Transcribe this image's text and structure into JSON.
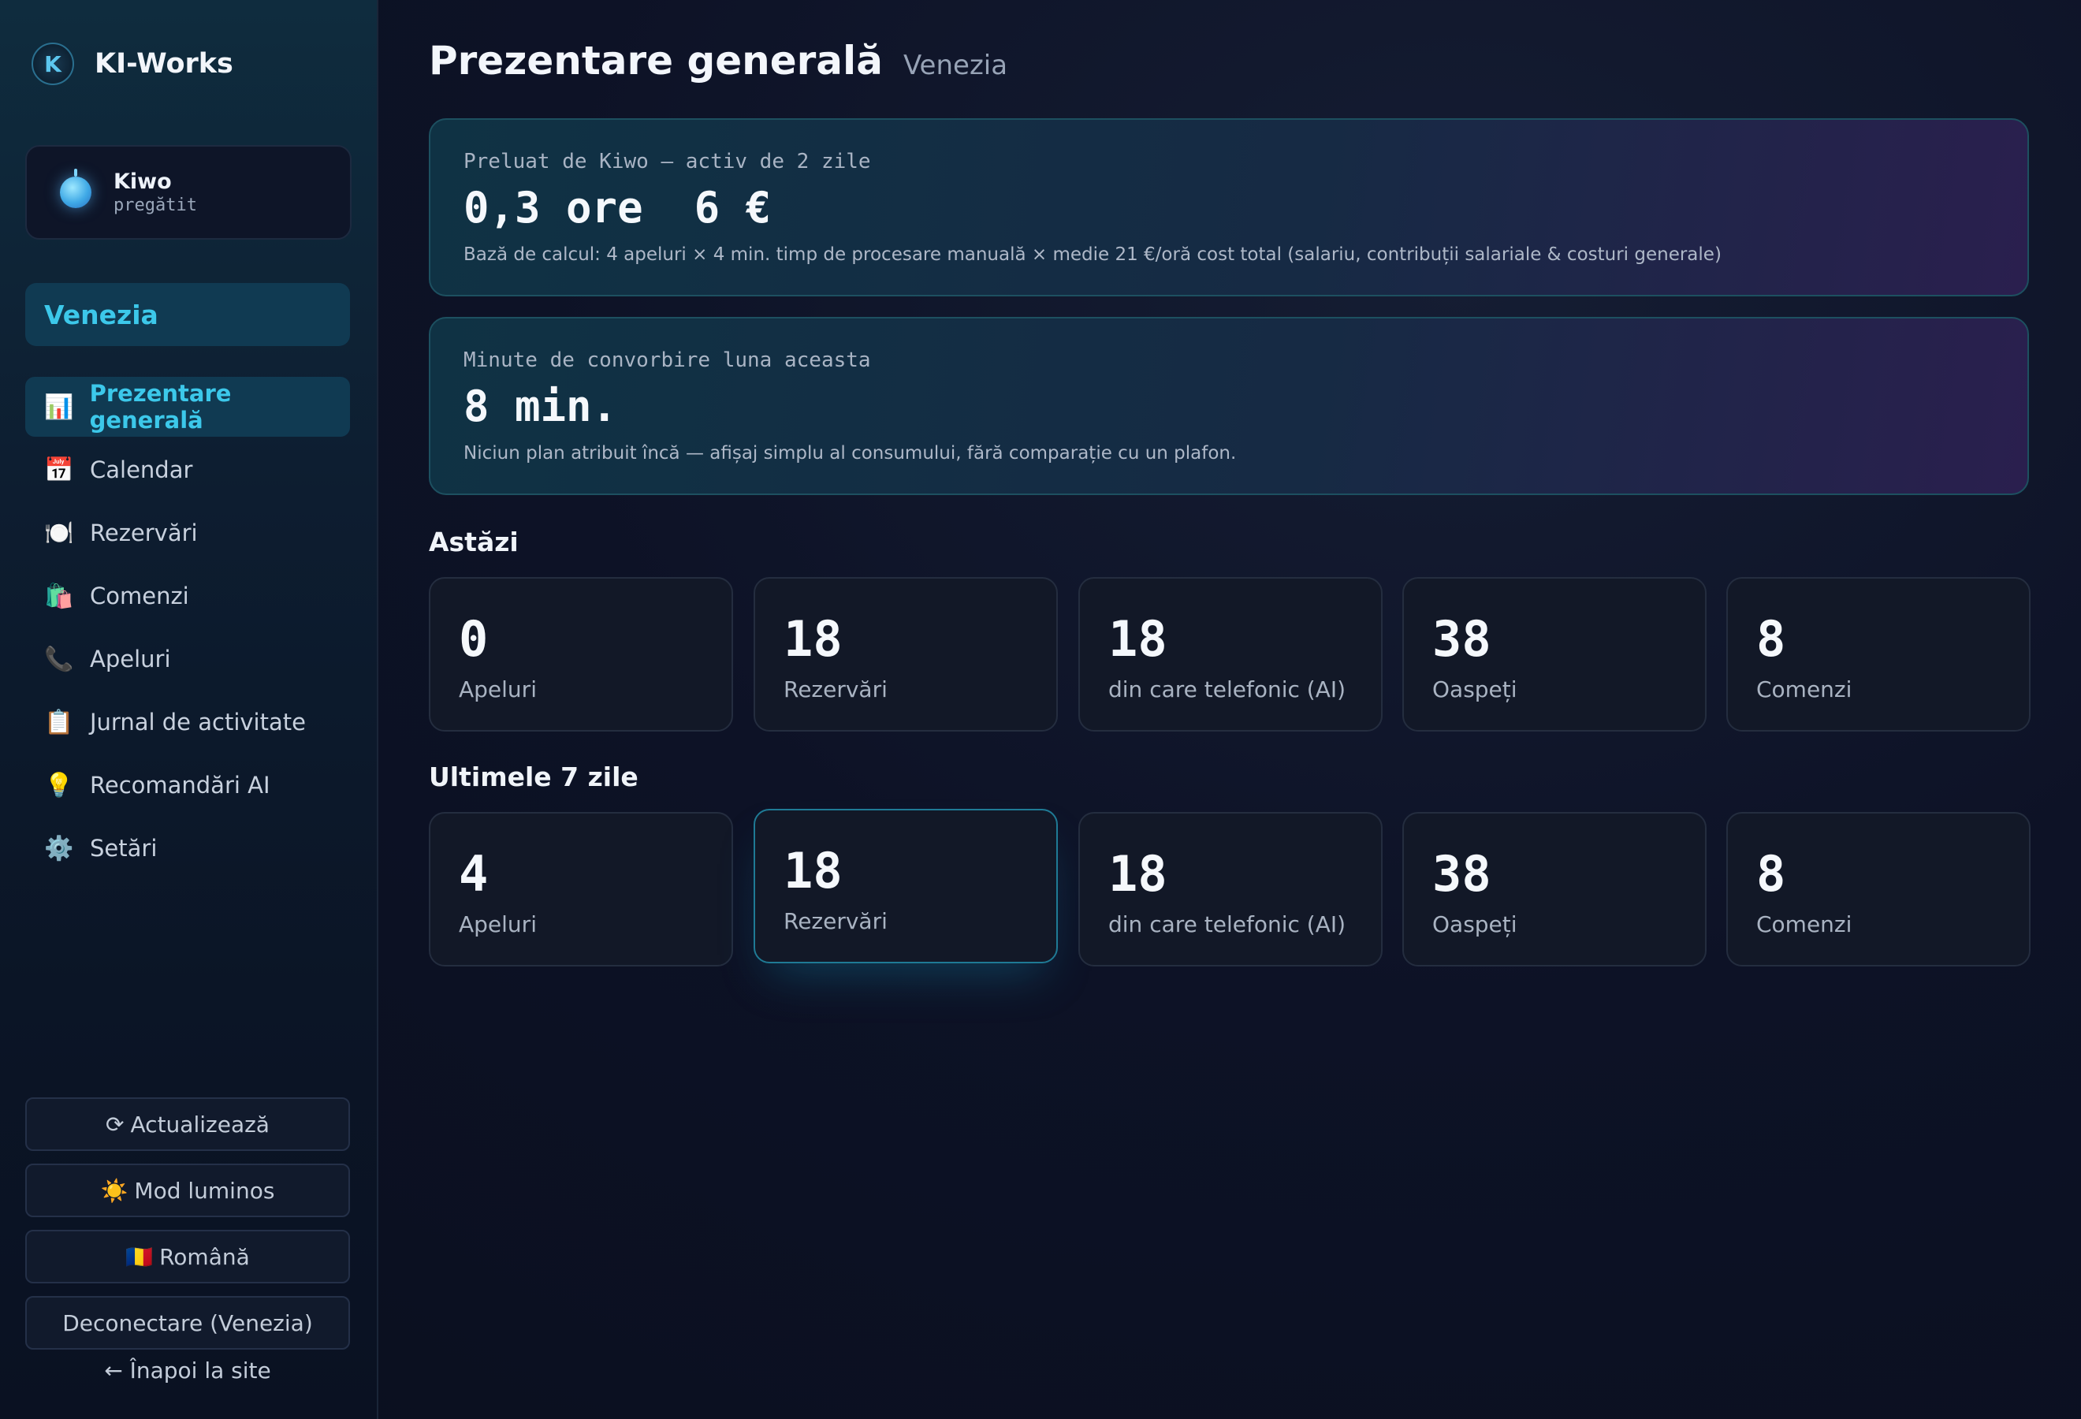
{
  "brand": {
    "logo_letter": "K",
    "name": "KI-Works"
  },
  "agent": {
    "name": "Kiwo",
    "status": "pregătit"
  },
  "location": "Venezia",
  "nav": [
    {
      "icon": "📊",
      "icon_name": "bar-chart-icon",
      "label": "Prezentare generală",
      "active": true
    },
    {
      "icon": "📅",
      "icon_name": "calendar-icon",
      "label": "Calendar"
    },
    {
      "icon": "🍽️",
      "icon_name": "plate-cutlery-icon",
      "label": "Rezervări"
    },
    {
      "icon": "🛍️",
      "icon_name": "shopping-bags-icon",
      "label": "Comenzi"
    },
    {
      "icon": "📞",
      "icon_name": "phone-icon",
      "label": "Apeluri"
    },
    {
      "icon": "📋",
      "icon_name": "clipboard-icon",
      "label": "Jurnal de activitate"
    },
    {
      "icon": "💡",
      "icon_name": "lightbulb-icon",
      "label": "Recomandări AI"
    },
    {
      "icon": "⚙️",
      "icon_name": "gear-icon",
      "label": "Setări"
    }
  ],
  "sidebar_buttons": {
    "refresh_icon": "⟳",
    "refresh": "Actualizează",
    "theme_icon": "☀️",
    "theme": "Mod luminos",
    "language_flag": "🇷🇴",
    "language": "Română",
    "logout": "Deconectare (Venezia)",
    "back": "← Înapoi la site"
  },
  "header": {
    "title": "Prezentare generală",
    "subtitle": "Venezia"
  },
  "savings": {
    "label": "Preluat de Kiwo — activ de 2 zile",
    "value": "0,3 ore  6 €",
    "note": "Bază de calcul: 4 apeluri × 4 min. timp de procesare manuală × medie 21 €/oră cost total (salariu, contribuții salariale & costuri generale)"
  },
  "minutes": {
    "label": "Minute de convorbire luna aceasta",
    "value": "8 min.",
    "note": "Niciun plan atribuit încă — afișaj simplu al consumului, fără comparație cu un plafon."
  },
  "today": {
    "title": "Astăzi",
    "stats": [
      {
        "value": "0",
        "label": "Apeluri"
      },
      {
        "value": "18",
        "label": "Rezervări"
      },
      {
        "value": "18",
        "label": "din care telefonic (AI)"
      },
      {
        "value": "38",
        "label": "Oaspeți"
      },
      {
        "value": "8",
        "label": "Comenzi"
      }
    ]
  },
  "week": {
    "title": "Ultimele 7 zile",
    "stats": [
      {
        "value": "4",
        "label": "Apeluri"
      },
      {
        "value": "18",
        "label": "Rezervări"
      },
      {
        "value": "18",
        "label": "din care telefonic (AI)"
      },
      {
        "value": "38",
        "label": "Oaspeți"
      },
      {
        "value": "8",
        "label": "Comenzi"
      }
    ]
  }
}
